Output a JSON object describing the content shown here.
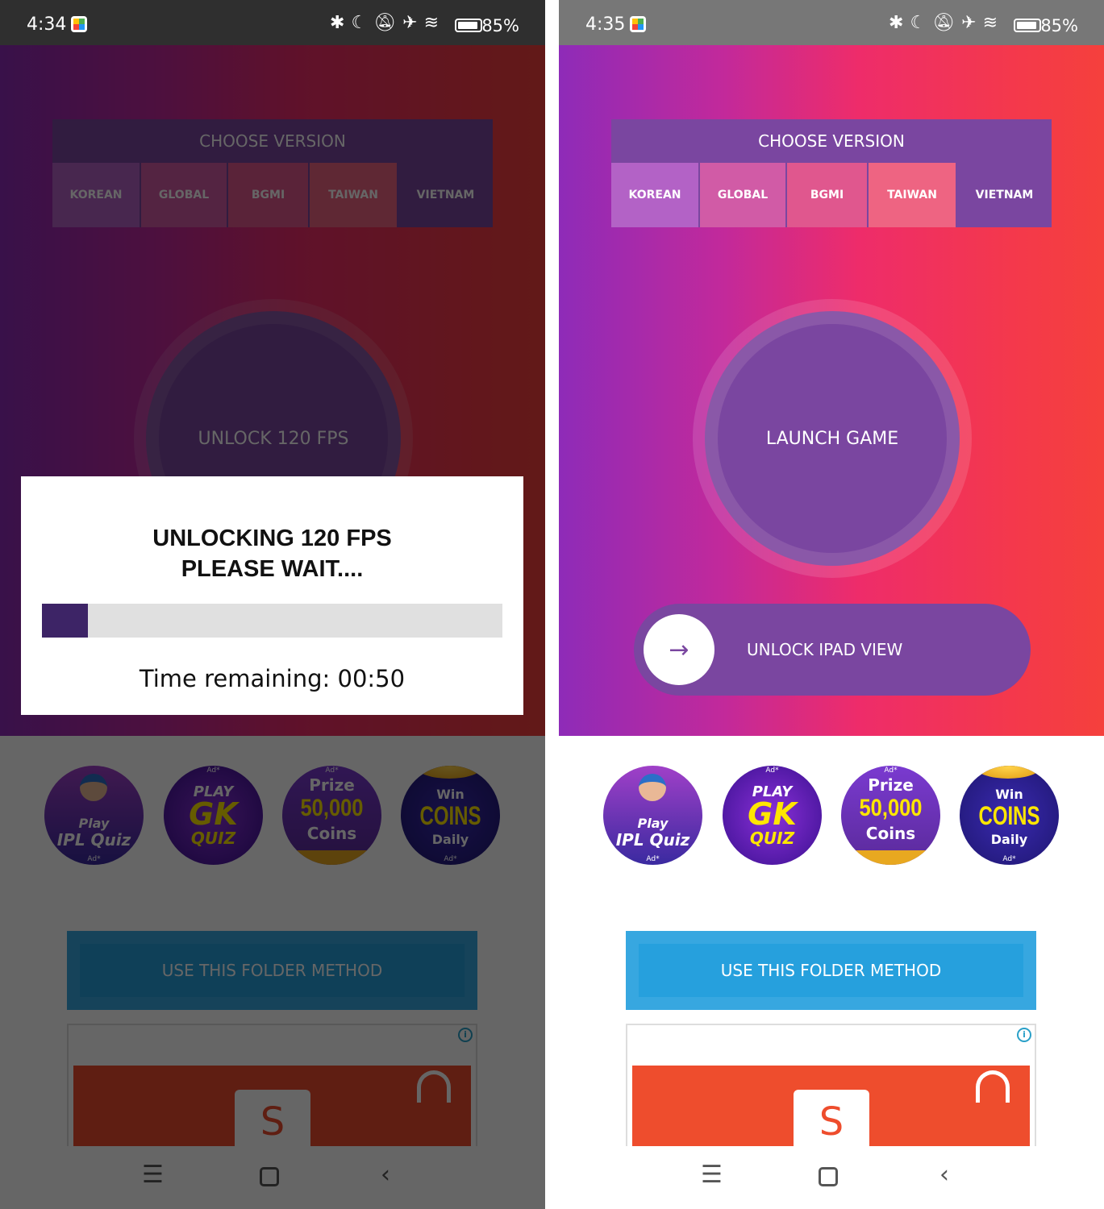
{
  "left": {
    "status": {
      "time": "4:34",
      "battery": "85%"
    },
    "choose_version": "CHOOSE VERSION",
    "tabs": [
      "KOREAN",
      "GLOBAL",
      "BGMI",
      "TAIWAN",
      "VIETNAM"
    ],
    "circle_label": "UNLOCK 120 FPS",
    "dialog": {
      "title_line1": "UNLOCKING 120 FPS",
      "title_line2": "PLEASE WAIT....",
      "progress_percent": 10,
      "time_remaining": "Time remaining: 00:50"
    }
  },
  "right": {
    "status": {
      "time": "4:35",
      "battery": "85%"
    },
    "choose_version": "CHOOSE VERSION",
    "tabs": [
      "KOREAN",
      "GLOBAL",
      "BGMI",
      "TAIWAN",
      "VIETNAM"
    ],
    "circle_label": "LAUNCH GAME",
    "pill_label": "UNLOCK IPAD VIEW"
  },
  "ads": [
    {
      "l1": "Play",
      "l2": "IPL Quiz",
      "tag": "Ad*"
    },
    {
      "l1": "PLAY",
      "l2": "GK",
      "l3": "QUIZ",
      "tag": "Ad*"
    },
    {
      "l1": "Prize",
      "l2": "50,000",
      "l3": "Coins",
      "tag": "Ad*"
    },
    {
      "l1": "Win",
      "l2": "COINS",
      "l3": "Daily",
      "tag": "Ad*"
    }
  ],
  "folder_button": "USE THIS FOLDER METHOD",
  "ad_banner": {
    "info_icon": "i",
    "logo_letter": "S"
  },
  "status_icons": [
    "bluetooth-icon",
    "moon-icon",
    "bell-off-icon",
    "airplane-icon",
    "wifi-icon",
    "battery-icon"
  ],
  "colors": {
    "accent": "#7a46a0",
    "folder": "#26a0dd",
    "progress": "#3d2466"
  }
}
